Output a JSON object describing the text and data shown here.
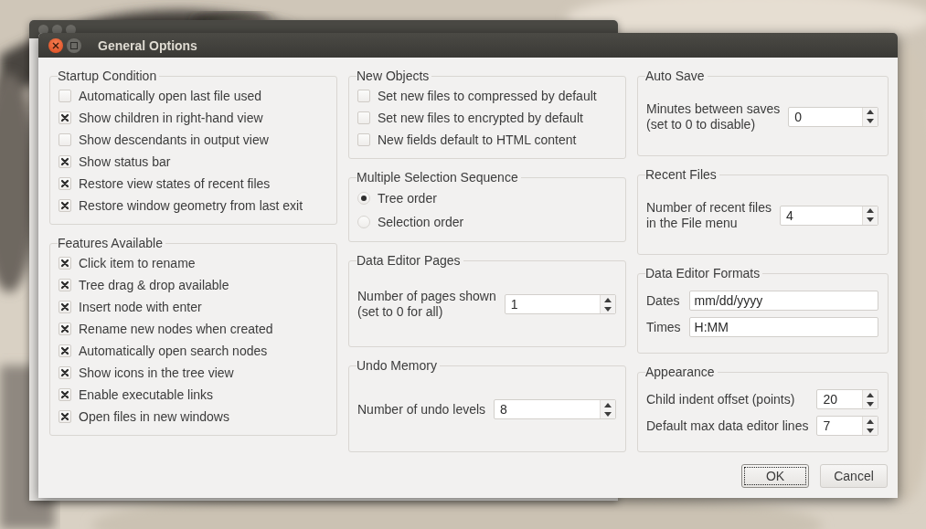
{
  "dialog": {
    "title": "General Options"
  },
  "columns": [
    [
      {
        "title": "Startup Condition",
        "kind": "checkboxes",
        "items": [
          {
            "label": "Automatically open last file used",
            "checked": false
          },
          {
            "label": "Show children in right-hand view",
            "checked": true
          },
          {
            "label": "Show descendants in output view",
            "checked": false
          },
          {
            "label": "Show status bar",
            "checked": true
          },
          {
            "label": "Restore view states of recent files",
            "checked": true
          },
          {
            "label": "Restore window geometry from last exit",
            "checked": true
          }
        ]
      },
      {
        "title": "Features Available",
        "kind": "checkboxes",
        "items": [
          {
            "label": "Click item to rename",
            "checked": true
          },
          {
            "label": "Tree drag & drop available",
            "checked": true
          },
          {
            "label": "Insert node with enter",
            "checked": true
          },
          {
            "label": "Rename new nodes when created",
            "checked": true
          },
          {
            "label": "Automatically open search nodes",
            "checked": true
          },
          {
            "label": "Show icons in the tree view",
            "checked": true
          },
          {
            "label": "Enable executable links",
            "checked": true
          },
          {
            "label": "Open files in new windows",
            "checked": true
          }
        ]
      }
    ],
    [
      {
        "title": "New Objects",
        "kind": "checkboxes",
        "items": [
          {
            "label": "Set new files to compressed by default",
            "checked": false
          },
          {
            "label": "Set new files to encrypted by default",
            "checked": false
          },
          {
            "label": "New fields default to HTML content",
            "checked": false
          }
        ]
      },
      {
        "title": "Multiple Selection Sequence",
        "kind": "radios",
        "items": [
          {
            "label": "Tree order",
            "selected": true
          },
          {
            "label": "Selection order",
            "selected": false
          }
        ]
      },
      {
        "title": "Data Editor Pages",
        "kind": "spins",
        "items": [
          {
            "label": "Number of pages shown\n(set to 0 for all)",
            "value": "1"
          }
        ]
      },
      {
        "title": "Undo Memory",
        "kind": "spins",
        "items": [
          {
            "label": "Number of undo levels",
            "value": "8"
          }
        ]
      }
    ],
    [
      {
        "title": "Auto Save",
        "kind": "spins",
        "items": [
          {
            "label": "Minutes between saves\n(set to 0 to disable)",
            "value": "0"
          }
        ]
      },
      {
        "title": "Recent Files",
        "kind": "spins",
        "items": [
          {
            "label": "Number of recent files\nin the File menu",
            "value": "4"
          }
        ]
      },
      {
        "title": "Data Editor Formats",
        "kind": "fields",
        "items": [
          {
            "label": "Dates",
            "value": "mm/dd/yyyy"
          },
          {
            "label": "Times",
            "value": "H:MM"
          }
        ]
      },
      {
        "title": "Appearance",
        "kind": "spins",
        "items": [
          {
            "label": "Child indent offset (points)",
            "value": "20"
          },
          {
            "label": "Default max data editor lines",
            "value": "7"
          }
        ]
      }
    ]
  ],
  "buttons": [
    {
      "label": "OK",
      "default": true
    },
    {
      "label": "Cancel",
      "default": false
    }
  ]
}
